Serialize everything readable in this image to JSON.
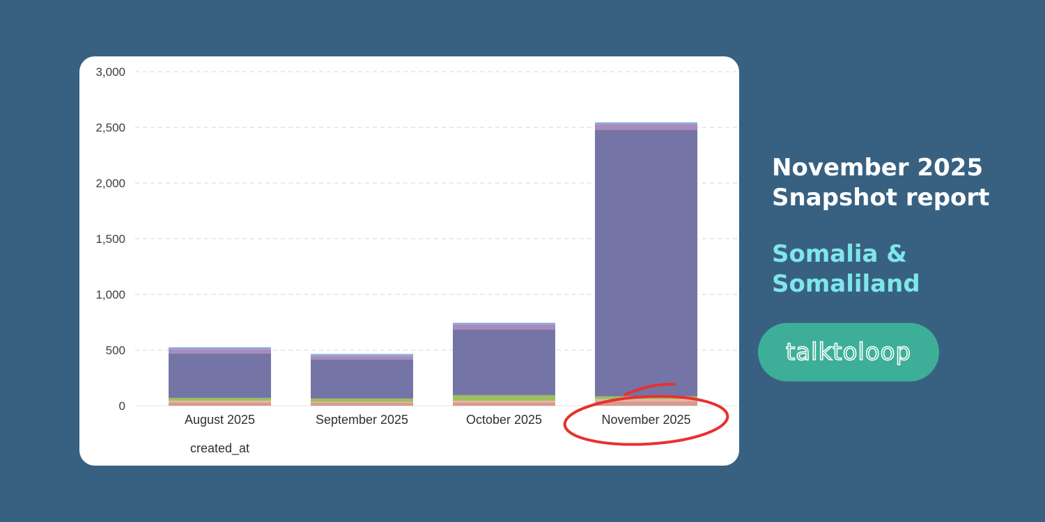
{
  "chart_data": {
    "type": "bar",
    "stacked": true,
    "categories": [
      "August 2025",
      "September 2025",
      "October 2025",
      "November 2025"
    ],
    "xlabel": "created_at",
    "ylabel": "",
    "ylim": [
      0,
      3000
    ],
    "yticks": [
      0,
      500,
      1000,
      1500,
      2000,
      2500,
      3000
    ],
    "ytick_labels": [
      "0",
      "500",
      "1,000",
      "1,500",
      "2,000",
      "2,500",
      "3,000"
    ],
    "grid": true,
    "series": [
      {
        "color": "#d99a8e",
        "values": [
          30,
          25,
          30,
          40
        ]
      },
      {
        "color": "#e8b4a6",
        "values": [
          15,
          10,
          15,
          20
        ]
      },
      {
        "color": "#9bbf5c",
        "values": [
          25,
          30,
          50,
          25
        ]
      },
      {
        "color": "#7474a6",
        "values": [
          400,
          350,
          590,
          2390
        ]
      },
      {
        "color": "#a98ab8",
        "values": [
          35,
          30,
          40,
          50
        ]
      },
      {
        "color": "#8fa7dd",
        "values": [
          20,
          20,
          20,
          20
        ]
      }
    ],
    "highlight": {
      "category": "November 2025",
      "color": "#e8312f"
    }
  },
  "report": {
    "title_line1": "November 2025",
    "title_line2": "Snapshot report",
    "region_line1": "Somalia &",
    "region_line2": "Somaliland"
  },
  "brand": {
    "name": "talktoloop",
    "pill_color": "#3daf98"
  }
}
